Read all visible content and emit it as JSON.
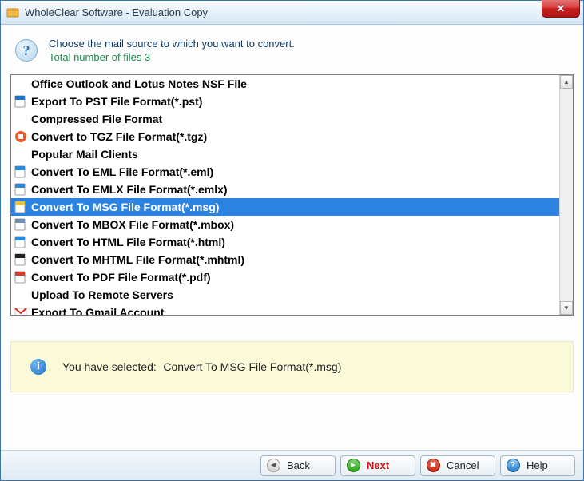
{
  "window": {
    "title": "WholeClear Software - Evaluation Copy"
  },
  "header": {
    "prompt": "Choose the mail source to which you want to convert.",
    "sub": "Total number of files 3"
  },
  "list": [
    {
      "type": "header",
      "label": "Office Outlook and Lotus Notes NSF File"
    },
    {
      "type": "item",
      "icon": "outlook",
      "label": "Export To PST File Format(*.pst)"
    },
    {
      "type": "header",
      "label": "Compressed File Format"
    },
    {
      "type": "item",
      "icon": "tgz",
      "label": "Convert to TGZ File Format(*.tgz)"
    },
    {
      "type": "header",
      "label": "Popular Mail Clients"
    },
    {
      "type": "item",
      "icon": "eml",
      "label": "Convert To EML File Format(*.eml)"
    },
    {
      "type": "item",
      "icon": "emlx",
      "label": "Convert To EMLX File Format(*.emlx)"
    },
    {
      "type": "item",
      "icon": "msg",
      "label": "Convert To MSG File Format(*.msg)",
      "selected": true
    },
    {
      "type": "item",
      "icon": "mbox",
      "label": "Convert To MBOX File Format(*.mbox)"
    },
    {
      "type": "item",
      "icon": "html",
      "label": "Convert To HTML File Format(*.html)"
    },
    {
      "type": "item",
      "icon": "mhtml",
      "label": "Convert To MHTML File Format(*.mhtml)"
    },
    {
      "type": "item",
      "icon": "pdf",
      "label": "Convert To PDF File Format(*.pdf)"
    },
    {
      "type": "header",
      "label": "Upload To Remote Servers"
    },
    {
      "type": "item",
      "icon": "gmail",
      "label": "Export To Gmail Account"
    }
  ],
  "info": {
    "text": "You have selected:- Convert To MSG File Format(*.msg)"
  },
  "footer": {
    "back": "Back",
    "next": "Next",
    "cancel": "Cancel",
    "help": "Help"
  },
  "icon_colors": {
    "outlook": "#1e73c8",
    "tgz": "#f05a28",
    "eml": "#2a89d6",
    "emlx": "#2a89d6",
    "msg": "#e8c23e",
    "mbox": "#6b8fb5",
    "html": "#2a89d6",
    "mhtml": "#222",
    "pdf": "#d43a2a",
    "gmail": "#d93025"
  }
}
